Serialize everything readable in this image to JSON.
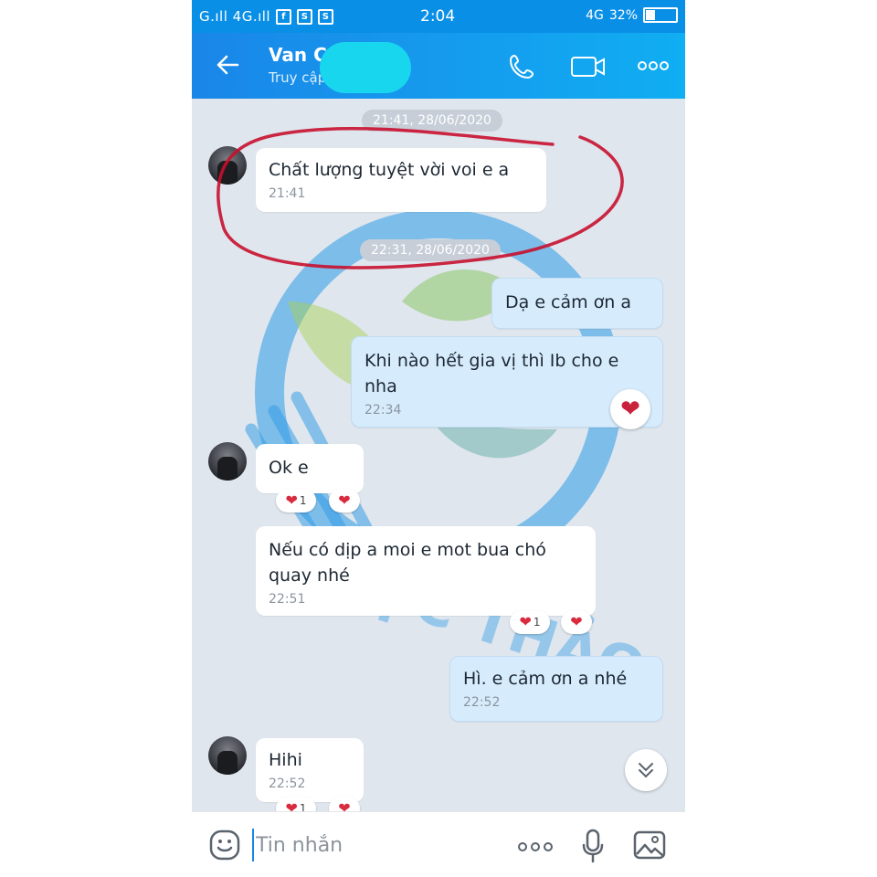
{
  "status_bar": {
    "signal": "G.ıll 4G.ıll",
    "time": "2:04",
    "network": "4G",
    "battery": "32%",
    "battery_level": 0.32,
    "app_icons": [
      "facebook-icon",
      "s-app-icon",
      "s-app-icon"
    ]
  },
  "header": {
    "contact_name": "Van C",
    "contact_status": "Truy cập",
    "accent": "#1a86e8"
  },
  "chat": {
    "timestamps": [
      "21:41, 28/06/2020",
      "22:31, 28/06/2020"
    ],
    "messages": [
      {
        "text": "Chất lượng tuyệt vời voi e a",
        "time": "21:41"
      },
      {
        "text": "Dạ e cảm ơn a"
      },
      {
        "text": "Khi nào hết gia vị thì Ib cho e nha",
        "time": "22:34"
      },
      {
        "text": "Ok e",
        "reaction_count": "1"
      },
      {
        "text": "Nếu có dịp a moi e mot bua chó quay nhé",
        "time": "22:51",
        "reaction_count": "1"
      },
      {
        "text": "Hì. e cảm ơn a nhé",
        "time": "22:52"
      },
      {
        "text": "Hihi",
        "time": "22:52",
        "reaction_count": "1"
      }
    ]
  },
  "watermark": {
    "text": "THỰC THẢO"
  },
  "input": {
    "placeholder": "Tin nhắn"
  },
  "colors": {
    "annotation": "#c8102e",
    "sent_bubble": "#d6ecfd",
    "heart": "#d92b3e"
  }
}
